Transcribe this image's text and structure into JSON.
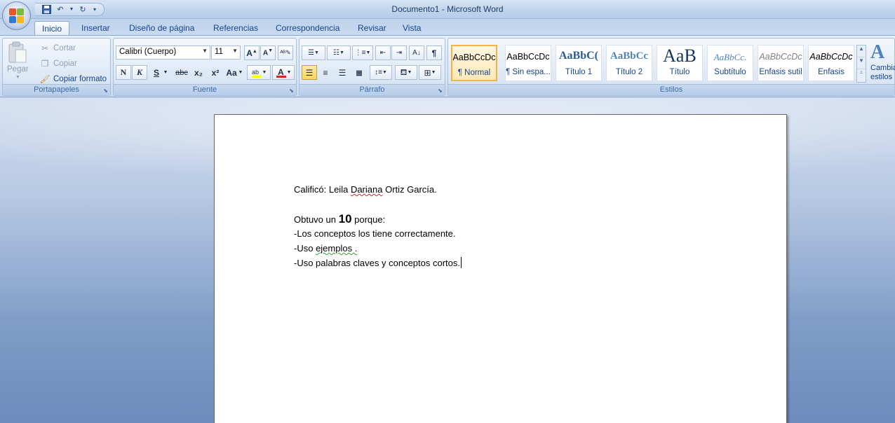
{
  "window": {
    "title": "Documento1 - Microsoft Word"
  },
  "quick_access": {
    "save_icon": "save-icon",
    "undo_icon": "undo-icon",
    "redo_icon": "redo-icon"
  },
  "tabs": [
    {
      "label": "Inicio"
    },
    {
      "label": "Insertar"
    },
    {
      "label": "Diseño de página"
    },
    {
      "label": "Referencias"
    },
    {
      "label": "Correspondencia"
    },
    {
      "label": "Revisar"
    },
    {
      "label": "Vista"
    }
  ],
  "clipboard": {
    "label": "Portapapeles",
    "paste": "Pegar",
    "cut": "Cortar",
    "copy": "Copiar",
    "format_painter": "Copiar formato"
  },
  "font": {
    "label": "Fuente",
    "family": "Calibri (Cuerpo)",
    "size": "11",
    "bold": "N",
    "italic": "K",
    "underline": "S",
    "strike": "abc",
    "subscript": "x₂",
    "superscript": "x²",
    "change_case": "Aa",
    "highlight_color": "#ffff00",
    "font_color": "#e0241b"
  },
  "paragraph": {
    "label": "Párrafo"
  },
  "styles": {
    "label": "Estilos",
    "items": [
      {
        "sample": "AaBbCcDc",
        "name": "¶ Normal"
      },
      {
        "sample": "AaBbCcDc",
        "name": "¶ Sin espa..."
      },
      {
        "sample": "AaBbC(",
        "name": "Título 1"
      },
      {
        "sample": "AaBbCc",
        "name": "Título 2"
      },
      {
        "sample": "AaB",
        "name": "Título"
      },
      {
        "sample": "AaBbCc.",
        "name": "Subtítulo"
      },
      {
        "sample": "AaBbCcDc",
        "name": "Énfasis sutil"
      },
      {
        "sample": "AaBbCcDc",
        "name": "Énfasis"
      }
    ],
    "change_styles": "Cambiar estilos"
  },
  "document": {
    "line1_prefix": "Calificó: Leila ",
    "line1_name": "Dariana",
    "line1_suffix": " Ortiz García.",
    "line2_prefix": "Obtuvo un ",
    "line2_grade": "10",
    "line2_suffix": " porque:",
    "line3": "-Los conceptos los tiene correctamente.",
    "line4_prefix": "-Uso ",
    "line4_flag": "ejemplos .",
    "line5": "-Uso palabras claves y conceptos cortos."
  }
}
